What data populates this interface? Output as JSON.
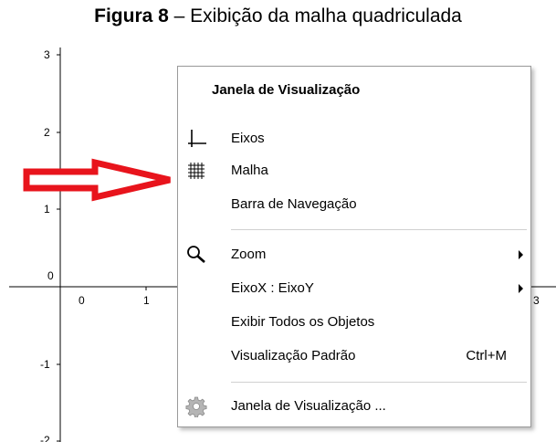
{
  "caption": {
    "fig_label": "Figura 8",
    "text": " – Exibição da malha quadriculada"
  },
  "graph": {
    "y_ticks": [
      "3",
      "2",
      "1",
      "0",
      "-1",
      "-2"
    ],
    "x_ticks": [
      "0",
      "1",
      "3"
    ]
  },
  "menu": {
    "title": "Janela de Visualização",
    "items": [
      {
        "label": "Eixos",
        "icon": "axes-icon"
      },
      {
        "label": "Malha",
        "icon": "grid-icon"
      },
      {
        "label": "Barra de Navegação"
      },
      {
        "label": "Zoom",
        "icon": "magnifier-icon",
        "submenu": true
      },
      {
        "label": "EixoX : EixoY",
        "submenu": true
      },
      {
        "label": "Exibir Todos os Objetos"
      },
      {
        "label": "Visualização Padrão",
        "shortcut": "Ctrl+M"
      },
      {
        "label": "Janela de Visualização ...",
        "icon": "gear-icon"
      }
    ]
  },
  "colors": {
    "arrow": "#e8141c",
    "menu_border": "#9a9a9a",
    "separator": "#d0d0d0"
  }
}
